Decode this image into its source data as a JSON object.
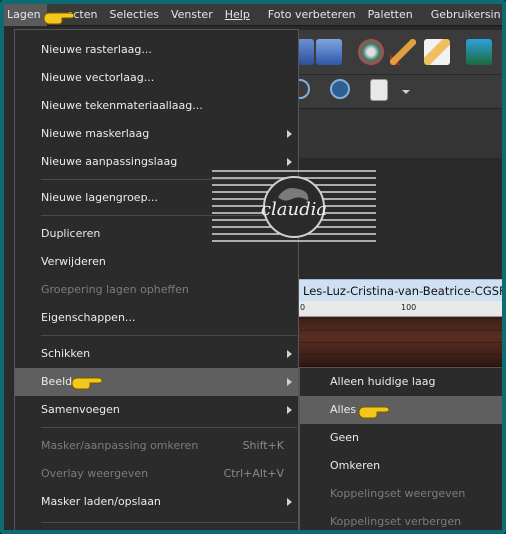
{
  "menubar": {
    "items": [
      "Lagen",
      "ecten",
      "Selecties",
      "Venster",
      "Help",
      "Foto verbeteren",
      "Paletten",
      "Gebruikersin"
    ]
  },
  "document": {
    "tab_title": "Les-Luz-Cristina-van-Beatrice-CGSFDe",
    "ruler_labels": [
      "0",
      "100"
    ]
  },
  "layers_menu": {
    "items": [
      {
        "label": "Nieuwe rasterlaag..."
      },
      {
        "label": "Nieuwe vectorlaag..."
      },
      {
        "label": "Nieuwe tekenmateriaallaag..."
      },
      {
        "label": "Nieuwe maskerlaag"
      },
      {
        "label": "Nieuwe aanpassingslaag"
      },
      {
        "label": "Nieuwe lagengroep..."
      },
      {
        "label": "Dupliceren"
      },
      {
        "label": "Verwijderen"
      },
      {
        "label": "Groepering lagen opheffen"
      },
      {
        "label": "Eigenschappen..."
      },
      {
        "label": "Schikken"
      },
      {
        "label": "Beeld"
      },
      {
        "label": "Samenvoegen"
      },
      {
        "label": "Masker/aanpassing omkeren",
        "shortcut": "Shift+K"
      },
      {
        "label": "Overlay weergeven",
        "shortcut": "Ctrl+Alt+V"
      },
      {
        "label": "Masker laden/opslaan"
      }
    ]
  },
  "beeld_submenu": {
    "items": [
      {
        "label": "Alleen huidige laag"
      },
      {
        "label": "Alles"
      },
      {
        "label": "Geen"
      },
      {
        "label": "Omkeren"
      },
      {
        "label": "Koppelingset weergeven"
      },
      {
        "label": "Koppelingset verbergen"
      }
    ]
  },
  "watermark": {
    "text": "claudia"
  },
  "colors": {
    "frame": "#0e6a73",
    "menu_bg": "#2b2b2b",
    "highlight": "#5f5f5f",
    "doc_tab": "#cfe0f2"
  }
}
